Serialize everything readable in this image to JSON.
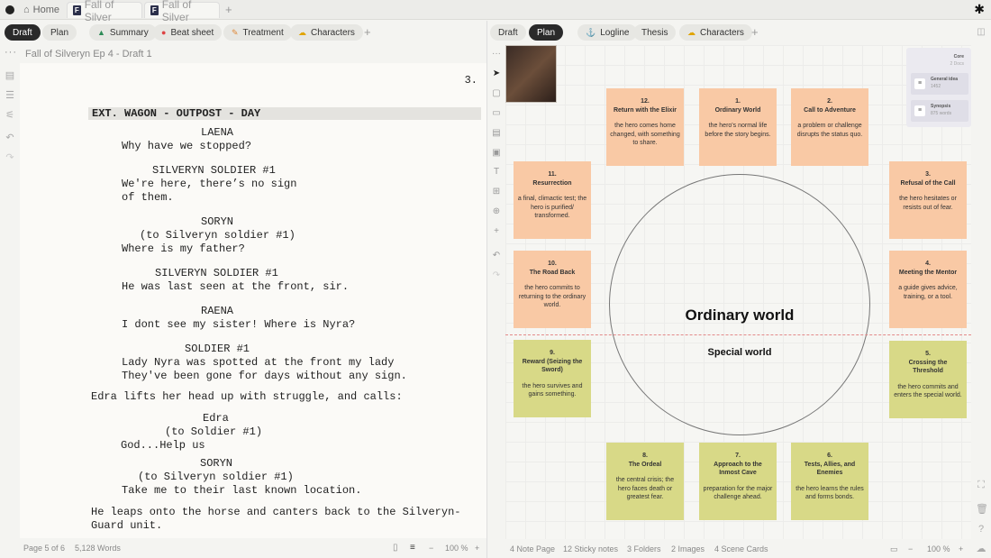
{
  "titlebar": {
    "home_label": "Home",
    "tabs": [
      "Fall of Silver",
      "Fall of Silver"
    ]
  },
  "left_panel": {
    "pills": [
      "Draft",
      "Plan",
      "Summary",
      "Beat sheet",
      "Treatment",
      "Characters"
    ],
    "doc_title": "Fall of Silveryn Ep 4 - Draft 1",
    "page_number": "3.",
    "scene_heading": "EXT. WAGON - OUTPOST - DAY",
    "lines": [
      "LAENA",
      "Why have we stopped?",
      "SILVERYN SOLDIER #1",
      "We're here, there’s no sign",
      "of them.",
      "SORYN",
      "(to Silveryn soldier #1)",
      "Where is my father?",
      "SILVERYN SOLDIER #1",
      "He was last seen at the front, sir.",
      "RAENA",
      "I dont see my sister! Where is Nyra?",
      "SOLDIER #1",
      "Lady Nyra was spotted at the front my lady",
      "They've been gone for days without any sign.",
      "Edra lifts her head up with struggle, and calls:",
      "Edra",
      "(to Soldier #1)",
      "God...Help us",
      "SORYN",
      "(to Silveryn soldier #1)",
      "Take me to their last known location.",
      "He leaps onto the horse and canters back to the Silveryn-",
      "Guard unit."
    ],
    "status": {
      "page": "Page 5 of 6",
      "words": "5,128 Words",
      "zoom": "100 %"
    }
  },
  "right_panel": {
    "pills": [
      "Draft",
      "Plan",
      "Logline",
      "Thesis",
      "Characters"
    ],
    "world_top": "Ordinary world",
    "world_bottom": "Special world",
    "core": {
      "title": "Core",
      "subtitle": "2 Docs",
      "items": [
        {
          "title": "General idea",
          "sub": "1452"
        },
        {
          "title": "Synopsis",
          "sub": "875 words"
        }
      ]
    },
    "cards": [
      {
        "num": "1.",
        "title": "Ordinary World",
        "desc": "the hero's normal life before the story begins."
      },
      {
        "num": "2.",
        "title": "Call to Adventure",
        "desc": "a problem or challenge disrupts the status quo."
      },
      {
        "num": "3.",
        "title": "Refusal of the Call",
        "desc": "the hero hesitates or resists out of fear."
      },
      {
        "num": "4.",
        "title": "Meeting the Mentor",
        "desc": "a guide gives advice, training, or a tool."
      },
      {
        "num": "5.",
        "title": "Crossing the Threshold",
        "desc": "the hero commits and enters the special world."
      },
      {
        "num": "6.",
        "title": "Tests, Allies, and Enemies",
        "desc": "the hero learns the rules and forms bonds."
      },
      {
        "num": "7.",
        "title": "Approach to the Inmost Cave",
        "desc": "preparation for the major challenge ahead."
      },
      {
        "num": "8.",
        "title": "The Ordeal",
        "desc": "the central crisis; the hero faces death or greatest fear."
      },
      {
        "num": "9.",
        "title": "Reward (Seizing the Sword)",
        "desc": "the hero survives and gains something."
      },
      {
        "num": "10.",
        "title": "The Road Back",
        "desc": "the hero commits to returning to the ordinary world."
      },
      {
        "num": "11.",
        "title": "Resurrection",
        "desc": "a final, climactic test; the hero is purified/ transformed."
      },
      {
        "num": "12.",
        "title": "Return with the Elixir",
        "desc": "the hero comes home changed, with something to share."
      }
    ],
    "status": {
      "pages": "4 Note Page",
      "stickies": "12 Sticky notes",
      "folders": "3 Folders",
      "images": "2 Images",
      "scenes": "4 Scene Cards",
      "zoom": "100 %"
    }
  }
}
